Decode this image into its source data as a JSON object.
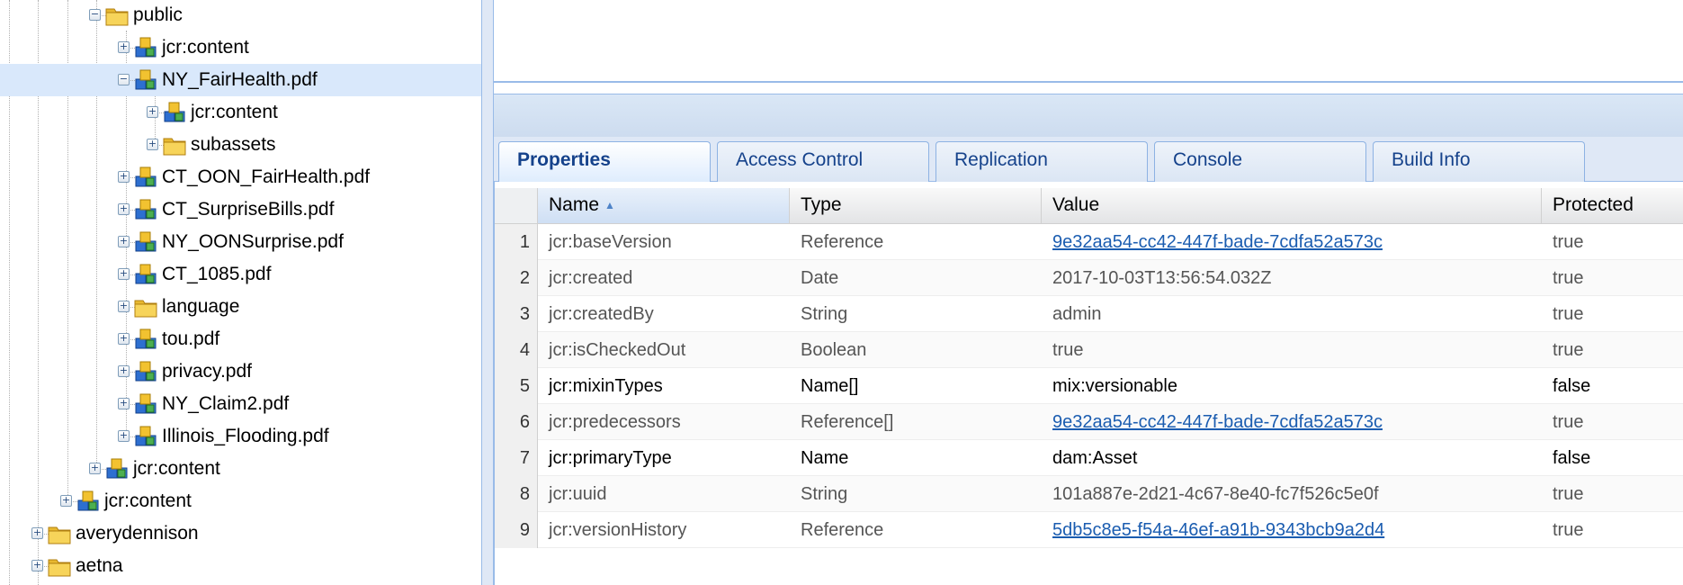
{
  "tree": {
    "items": [
      {
        "label": "public",
        "icon": "folder-icon",
        "toggle": "minus"
      },
      {
        "label": "jcr:content",
        "icon": "node-icon",
        "toggle": "plus"
      },
      {
        "label": "NY_FairHealth.pdf",
        "icon": "node-icon",
        "toggle": "minus",
        "selected": true
      },
      {
        "label": "jcr:content",
        "icon": "node-icon",
        "toggle": "plus"
      },
      {
        "label": "subassets",
        "icon": "folder-icon",
        "toggle": "plus"
      },
      {
        "label": "CT_OON_FairHealth.pdf",
        "icon": "node-icon",
        "toggle": "plus"
      },
      {
        "label": "CT_SurpriseBills.pdf",
        "icon": "node-icon",
        "toggle": "plus"
      },
      {
        "label": "NY_OONSurprise.pdf",
        "icon": "node-icon",
        "toggle": "plus"
      },
      {
        "label": "CT_1085.pdf",
        "icon": "node-icon",
        "toggle": "plus"
      },
      {
        "label": "language",
        "icon": "folder-icon",
        "toggle": "plus"
      },
      {
        "label": "tou.pdf",
        "icon": "node-icon",
        "toggle": "plus"
      },
      {
        "label": "privacy.pdf",
        "icon": "node-icon",
        "toggle": "plus"
      },
      {
        "label": "NY_Claim2.pdf",
        "icon": "node-icon",
        "toggle": "plus"
      },
      {
        "label": "Illinois_Flooding.pdf",
        "icon": "node-icon",
        "toggle": "plus"
      },
      {
        "label": "jcr:content",
        "icon": "node-icon",
        "toggle": "plus"
      },
      {
        "label": "jcr:content",
        "icon": "node-icon",
        "toggle": "plus"
      },
      {
        "label": "averydennison",
        "icon": "folder-icon",
        "toggle": "plus"
      },
      {
        "label": "aetna",
        "icon": "folder-icon",
        "toggle": "plus"
      }
    ]
  },
  "tabs": [
    {
      "label": "Properties",
      "active": true
    },
    {
      "label": "Access Control"
    },
    {
      "label": "Replication"
    },
    {
      "label": "Console"
    },
    {
      "label": "Build Info"
    }
  ],
  "grid": {
    "columns": [
      "Name",
      "Type",
      "Value",
      "Protected"
    ],
    "sort_indicator": "▲",
    "rows": [
      {
        "num": "1",
        "name": "jcr:baseVersion",
        "type": "Reference",
        "value": "9e32aa54-cc42-447f-bade-7cdfa52a573c",
        "link": true,
        "protected": "true"
      },
      {
        "num": "2",
        "name": "jcr:created",
        "type": "Date",
        "value": "2017-10-03T13:56:54.032Z",
        "protected": "true"
      },
      {
        "num": "3",
        "name": "jcr:createdBy",
        "type": "String",
        "value": "admin",
        "protected": "true"
      },
      {
        "num": "4",
        "name": "jcr:isCheckedOut",
        "type": "Boolean",
        "value": "true",
        "protected": "true"
      },
      {
        "num": "5",
        "name": "jcr:mixinTypes",
        "type": "Name[]",
        "value": "mix:versionable",
        "protected": "false",
        "editable": true
      },
      {
        "num": "6",
        "name": "jcr:predecessors",
        "type": "Reference[]",
        "value": "9e32aa54-cc42-447f-bade-7cdfa52a573c",
        "link": true,
        "protected": "true"
      },
      {
        "num": "7",
        "name": "jcr:primaryType",
        "type": "Name",
        "value": "dam:Asset",
        "protected": "false",
        "editable": true
      },
      {
        "num": "8",
        "name": "jcr:uuid",
        "type": "String",
        "value": "101a887e-2d21-4c67-8e40-fc7f526c5e0f",
        "protected": "true"
      },
      {
        "num": "9",
        "name": "jcr:versionHistory",
        "type": "Reference",
        "value": "5db5c8e5-f54a-46ef-a91b-9343bcb9a2d4",
        "link": true,
        "protected": "true"
      }
    ]
  }
}
